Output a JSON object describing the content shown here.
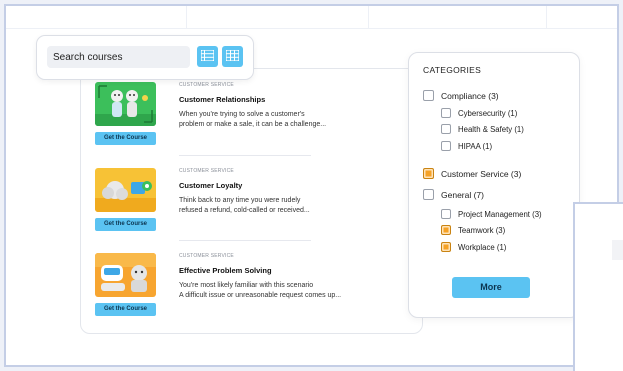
{
  "search": {
    "placeholder": "Search courses"
  },
  "courses": [
    {
      "category": "CUSTOMER SERVICE",
      "title": "Customer Relationships",
      "desc_line1": "When you're trying to solve a customer's",
      "desc_line2": "problem or make a sale, it can be a challenge...",
      "button": "Get the Course"
    },
    {
      "category": "CUSTOMER SERVICE",
      "title": "Customer Loyalty",
      "desc_line1": "Think back to any time you were rudely",
      "desc_line2": "refused a refund, cold-called or received...",
      "button": "Get the Course"
    },
    {
      "category": "CUSTOMER SERVICE",
      "title": "Effective Problem Solving",
      "desc_line1": "You're most likely familiar with this scenario",
      "desc_line2": "A difficult issue or unreasonable request comes up...",
      "button": "Get the Course"
    }
  ],
  "categories": {
    "heading": "CATEGORIES",
    "items": [
      {
        "label": "Compliance (3)",
        "checked": false
      },
      {
        "label": "Cybersecurity (1)",
        "checked": false
      },
      {
        "label": "Health & Safety (1)",
        "checked": false
      },
      {
        "label": "HIPAA (1)",
        "checked": false
      },
      {
        "label": "Customer Service (3)",
        "checked": true
      },
      {
        "label": "General (7)",
        "checked": false
      },
      {
        "label": "Project Management (3)",
        "checked": false
      },
      {
        "label": "Teamwork (3)",
        "checked": true
      },
      {
        "label": "Workplace (1)",
        "checked": true
      }
    ],
    "more": "More"
  },
  "colors": {
    "accent": "#5bc3f2",
    "checked": "#f5a227"
  }
}
